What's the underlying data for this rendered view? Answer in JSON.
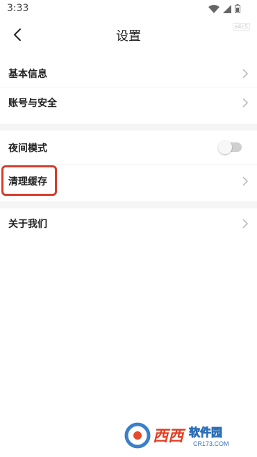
{
  "status_bar": {
    "time": "3:33"
  },
  "header": {
    "title": "设置",
    "badge": "e4c5"
  },
  "sections": {
    "basic_info": "基本信息",
    "account_security": "账号与安全",
    "night_mode": "夜间模式",
    "clear_cache": "清理缓存",
    "about_us": "关于我们"
  },
  "night_mode_enabled": false,
  "watermark": {
    "brand": "西西软件园",
    "domain": "CR173.COM"
  },
  "colors": {
    "highlight": "#d43d2a",
    "toggle_off": "#d0d0d0",
    "section_gap": "#f5f5f5"
  }
}
